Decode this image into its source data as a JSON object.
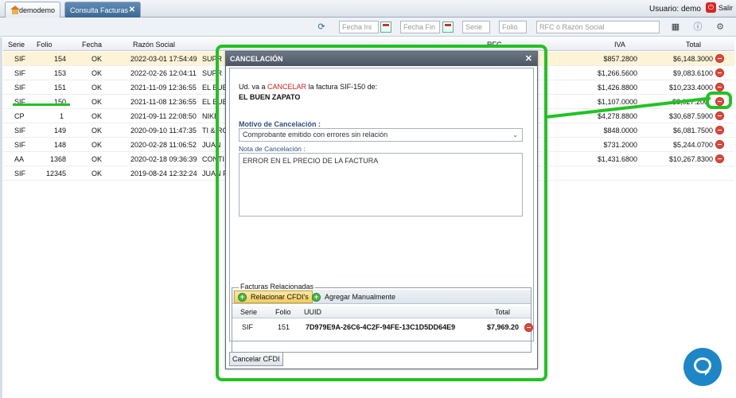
{
  "topbar": {
    "home_tab": "demodemo",
    "active_tab": "Consulta Facturas",
    "close_glyph": "✕",
    "user_label": "Usuario: demo",
    "logout": "Salir"
  },
  "toolbar": {
    "fecha_ini": "Fecha Ini",
    "fecha_fin": "Fecha Fin",
    "serie": "Serie",
    "folio": "Folio",
    "rfc": "RFC ó Razón Social",
    "icons": [
      "refresh-icon",
      "calendar-icon",
      "calculator-icon",
      "info-icon",
      "settings-icon"
    ]
  },
  "grid": {
    "columns": [
      "Serie",
      "Folio",
      "Fecha",
      "Razón Social",
      "RFC",
      "IVA",
      "Total"
    ],
    "rows": [
      {
        "serie": "SIF",
        "folio": "154",
        "estado": "OK",
        "fecha": "2022-03-01 17:54:49",
        "razon": "SUPR",
        "iva": "$857.2800",
        "total": "$6,148.3000"
      },
      {
        "serie": "SIF",
        "folio": "153",
        "estado": "OK",
        "fecha": "2022-02-26 12:04:11",
        "razon": "SUPR",
        "iva": "$1,266.5600",
        "total": "$9,083.6100"
      },
      {
        "serie": "SIF",
        "folio": "151",
        "estado": "OK",
        "fecha": "2021-11-09 12:36:55",
        "razon": "EL BUEN",
        "iva": "$1,426.8800",
        "total": "$10,233.4000"
      },
      {
        "serie": "SIF",
        "folio": "150",
        "estado": "OK",
        "fecha": "2021-11-08 12:36:55",
        "razon": "EL BUEN",
        "iva": "$1,107.0000",
        "total": "$8,027.200"
      },
      {
        "serie": "CP",
        "folio": "1",
        "estado": "OK",
        "fecha": "2021-09-11 22:08:50",
        "razon": "NIKE",
        "iva": "$4,278.8800",
        "total": "$30,687.5900"
      },
      {
        "serie": "SIF",
        "folio": "149",
        "estado": "OK",
        "fecha": "2020-09-10 11:47:35",
        "razon": "TI & RO",
        "iva": "$848.0000",
        "total": "$6,081.7500"
      },
      {
        "serie": "SIF",
        "folio": "148",
        "estado": "OK",
        "fecha": "2020-02-28 11:06:52",
        "razon": "JUAN",
        "iva": "$731.2000",
        "total": "$5,244.0700"
      },
      {
        "serie": "AA",
        "folio": "1368",
        "estado": "OK",
        "fecha": "2020-02-18 09:36:39",
        "razon": "CONTI",
        "iva": "$1,431.6800",
        "total": "$10,267.8300"
      },
      {
        "serie": "SIF",
        "folio": "12345",
        "estado": "OK",
        "fecha": "2019-08-24 12:32:24",
        "razon": "JUAN P",
        "iva": "",
        "total": ""
      }
    ]
  },
  "dialog": {
    "title": "CANCELACIÓN",
    "close_glyph": "✕",
    "message_prefix": "Ud. va a",
    "message_action": "CANCELAR",
    "message_suffix": "la factura SIF-150  de:",
    "customer": "EL BUEN ZAPATO",
    "motivo_label": "Motivo de Cancelación :",
    "motivo_value": "Comprobante emitido con errores sin relación",
    "nota_label": "Nota de Cancelación :",
    "nota_value": "ERROR EN EL PRECIO DE LA FACTURA",
    "related": {
      "legend": "Facturas Relacionadas",
      "btn_relacionar": "Relacionar CFDI's",
      "btn_agregar": "Agregar Manualmente",
      "columns": [
        "Serie",
        "Folio",
        "UUID",
        "Total"
      ],
      "row": {
        "serie": "SIF",
        "folio": "151",
        "uuid": "7D979E9A-26C6-4C2F-94FE-13C1D5DD64E9",
        "total": "$7,969.20"
      }
    },
    "cancel_button": "Cancelar CFDI"
  },
  "colors": {
    "highlight": "#22c222",
    "danger": "#e2463d",
    "chat": "#1c86c7"
  }
}
